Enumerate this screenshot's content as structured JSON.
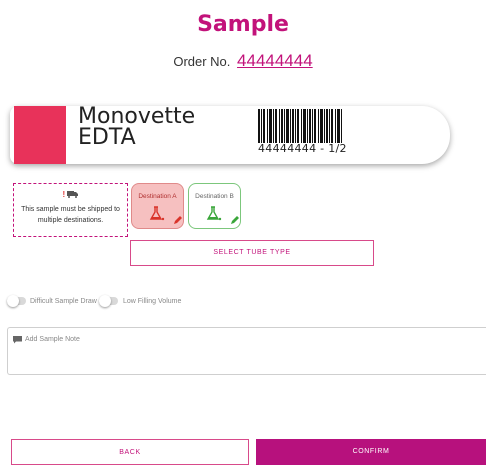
{
  "header": {
    "title": "Sample",
    "order_label": "Order No.",
    "order_number": "44444444"
  },
  "tube": {
    "name_line1": "Monovette",
    "name_line2": "EDTA",
    "color": "#e8325a",
    "barcode_text": "44444444 - 1/2",
    "barcode_icon": "barcode"
  },
  "notice": {
    "icons": [
      "exclamation-icon",
      "truck-icon"
    ],
    "text": "This sample must be shipped to multiple destinations."
  },
  "destinations": [
    {
      "label": "Destination A",
      "icon": "flask-icon",
      "edit_icon": "pencil-icon",
      "selected": true
    },
    {
      "label": "Destination B",
      "icon": "flask-icon",
      "edit_icon": "pencil-icon",
      "selected": false
    }
  ],
  "select_tube_type": "SELECT TUBE TYPE",
  "toggles": [
    {
      "label": "Difficult Sample Draw",
      "on": false
    },
    {
      "label": "Low Filling Volume",
      "on": false
    }
  ],
  "note": {
    "placeholder": "Add Sample Note",
    "icon": "comment-icon"
  },
  "footer": {
    "back_label": "BACK",
    "confirm_label": "CONFIRM"
  },
  "colors": {
    "accent": "#c2127a",
    "confirm_bg": "#b7117d",
    "dest_a_bg": "#f6c0c0",
    "dest_b_border": "#7cc77c"
  }
}
